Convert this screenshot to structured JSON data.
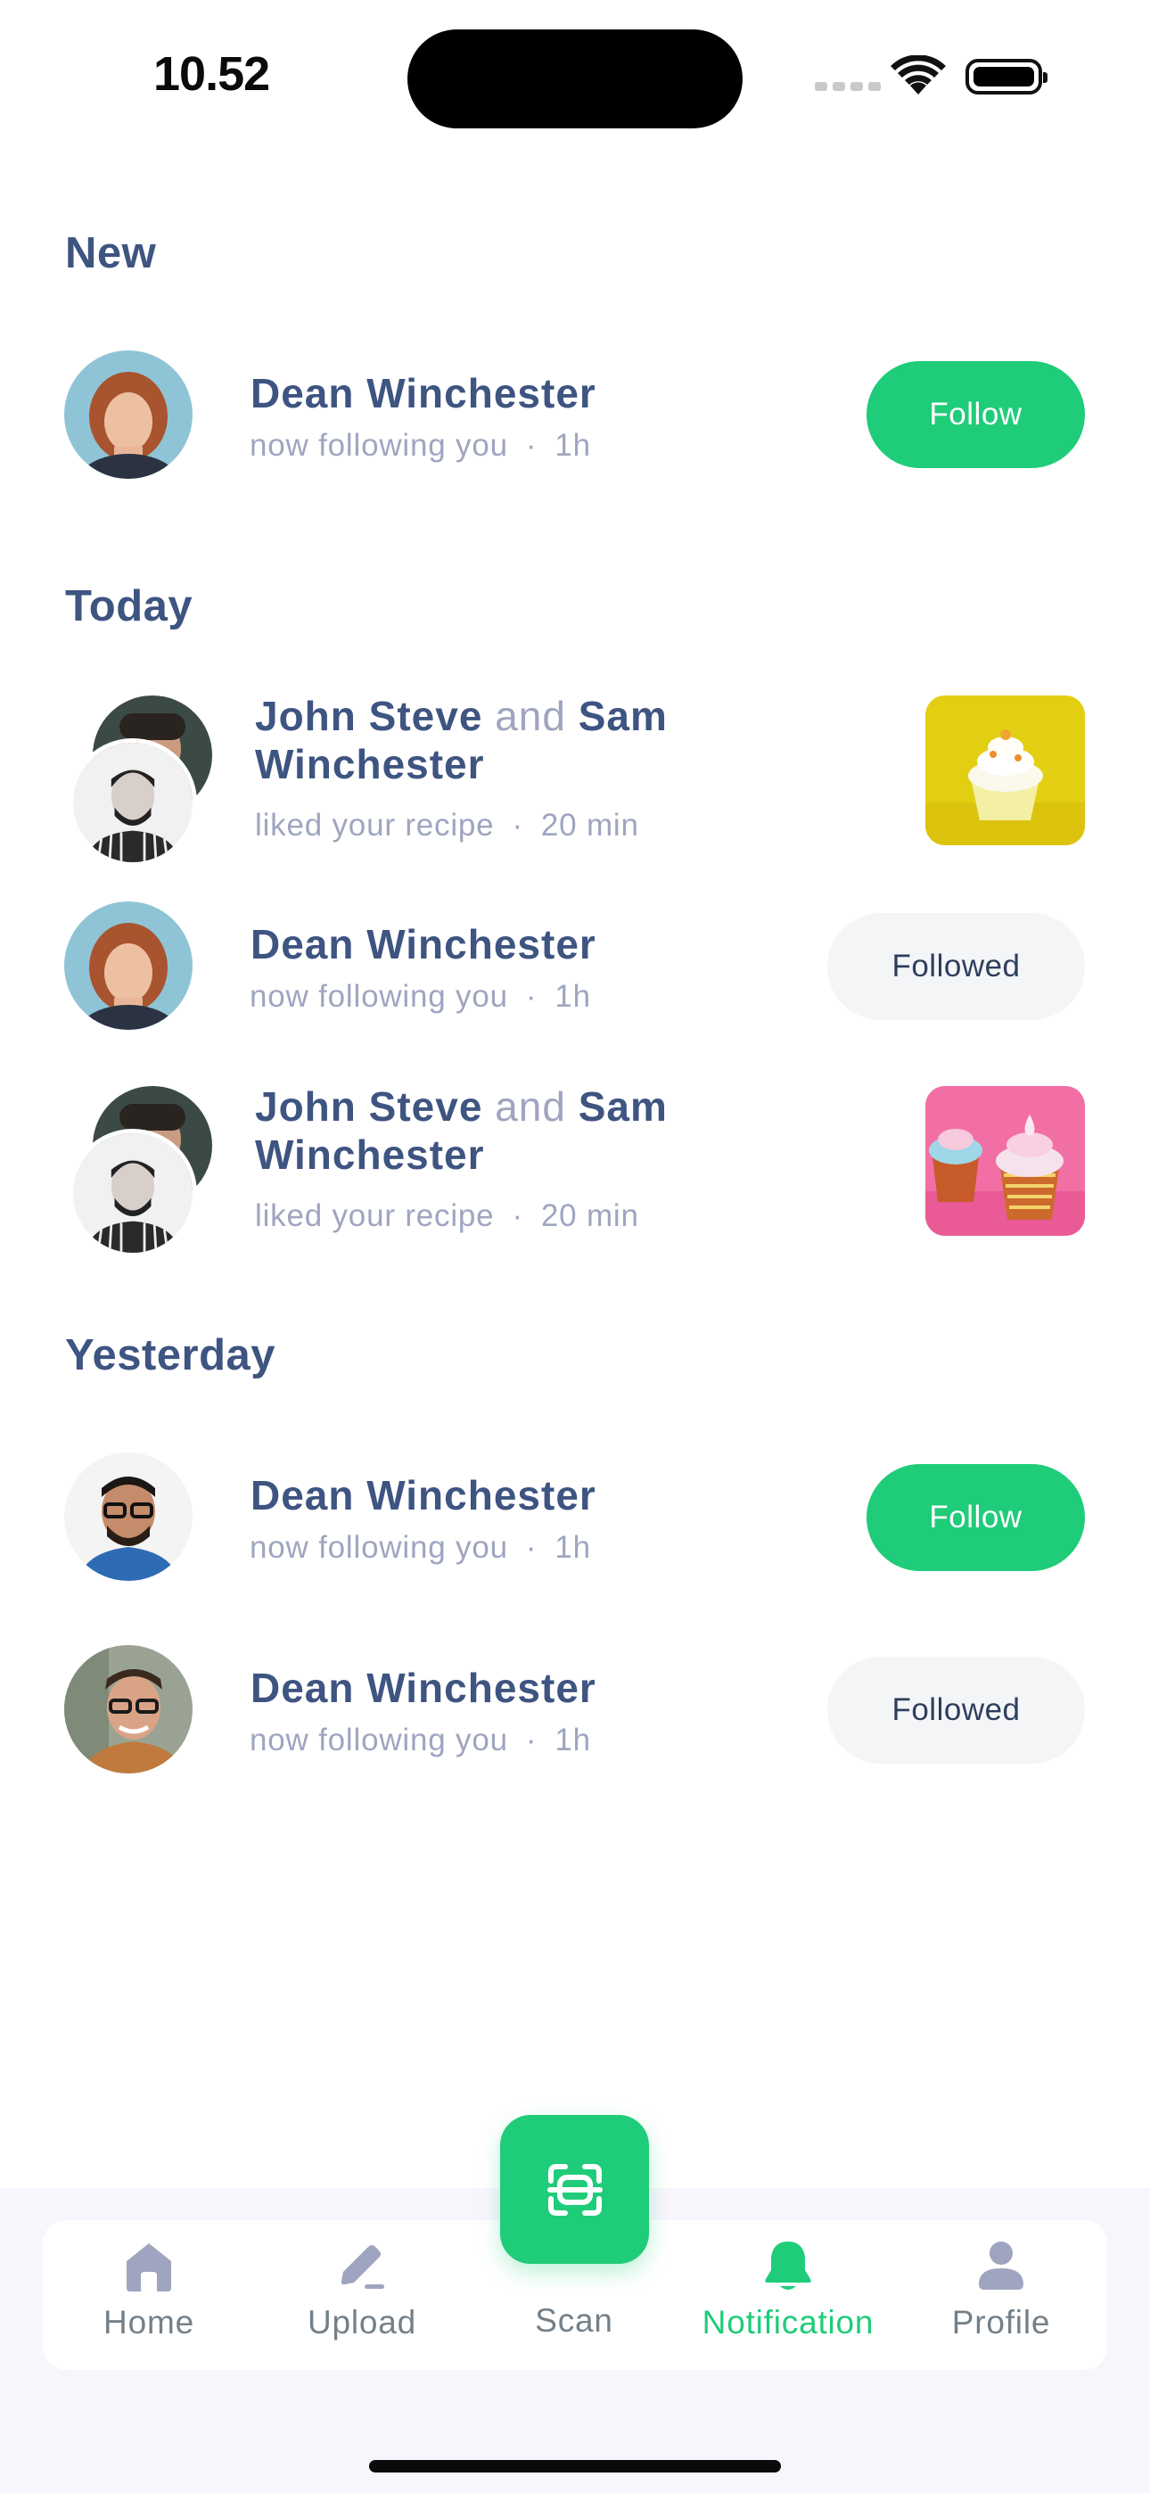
{
  "status_bar": {
    "time": "10.52"
  },
  "sections": {
    "new": "New",
    "today": "Today",
    "yesterday": "Yesterday"
  },
  "notifications": [
    {
      "name": "Dean Winchester",
      "action": "now following you",
      "dot": "·",
      "time": "1h",
      "button": "Follow"
    },
    {
      "name_a": "John Steve",
      "joiner": "and",
      "name_b": "Sam Winchester",
      "action": "liked your recipe",
      "dot": "·",
      "time": "20 min",
      "thumbnail": "yellow-cupcake"
    },
    {
      "name": "Dean Winchester",
      "action": "now following you",
      "dot": "·",
      "time": "1h",
      "button": "Followed"
    },
    {
      "name_a": "John Steve",
      "joiner": "and",
      "name_b": "Sam Winchester",
      "action": "liked your recipe",
      "dot": "·",
      "time": "20 min",
      "thumbnail": "pink-cupcakes"
    },
    {
      "name": "Dean Winchester",
      "action": "now following you",
      "dot": "·",
      "time": "1h",
      "button": "Follow"
    },
    {
      "name": "Dean Winchester",
      "action": "now following you",
      "dot": "·",
      "time": "1h",
      "button": "Followed"
    }
  ],
  "bottom_nav": {
    "items": [
      {
        "label": "Home",
        "icon": "home-icon"
      },
      {
        "label": "Upload",
        "icon": "pencil-icon"
      },
      {
        "label": "Scan",
        "icon": "scan-icon"
      },
      {
        "label": "Notification",
        "icon": "bell-icon",
        "active": true
      },
      {
        "label": "Profile",
        "icon": "profile-icon"
      }
    ]
  },
  "colors": {
    "accent": "#1fcc79",
    "title": "#3e5481",
    "secondary": "#9fa5c0",
    "followed_bg": "#f4f5f7"
  }
}
